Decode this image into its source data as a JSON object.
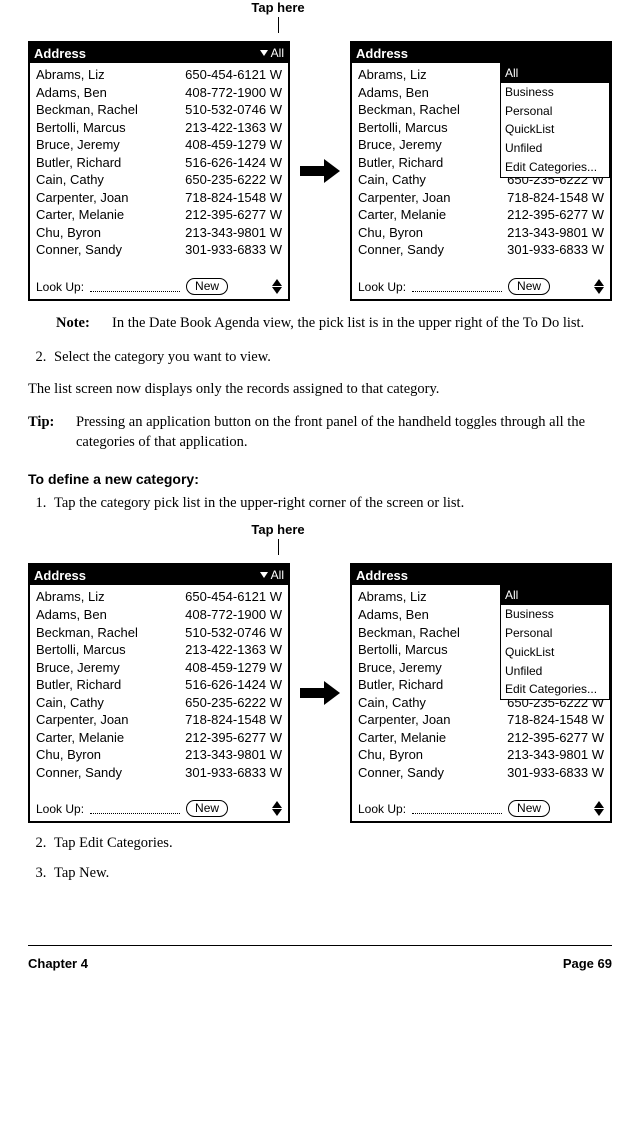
{
  "fig1": {
    "tap_here_label": "Tap here",
    "header_title": "Address",
    "cat_picker_value": "All",
    "lookup_label": "Look Up:",
    "new_btn_label": "New",
    "entries": [
      {
        "name": "Abrams, Liz",
        "num": "650-454-6121 W"
      },
      {
        "name": "Adams, Ben",
        "num": "408-772-1900 W"
      },
      {
        "name": "Beckman, Rachel",
        "num": "510-532-0746 W"
      },
      {
        "name": "Bertolli, Marcus",
        "num": "213-422-1363 W"
      },
      {
        "name": "Bruce, Jeremy",
        "num": "408-459-1279 W"
      },
      {
        "name": "Butler, Richard",
        "num": "516-626-1424 W"
      },
      {
        "name": "Cain, Cathy",
        "num": "650-235-6222 W"
      },
      {
        "name": "Carpenter, Joan",
        "num": "718-824-1548 W"
      },
      {
        "name": "Carter, Melanie",
        "num": "212-395-6277 W"
      },
      {
        "name": "Chu, Byron",
        "num": "213-343-9801 W"
      },
      {
        "name": "Conner, Sandy",
        "num": "301-933-6833 W"
      }
    ],
    "dropdown": {
      "selected": "All",
      "items": [
        "All",
        "Business",
        "Personal",
        "QuickList",
        "Unfiled",
        "Edit Categories..."
      ]
    }
  },
  "note": {
    "label": "Note:",
    "text": "In the Date Book Agenda view, the pick list is in the upper right of the To Do list."
  },
  "step2_text": "Select the category you want to view.",
  "post_step_text": "The list screen now displays only the records assigned to that category.",
  "tip": {
    "label": "Tip:",
    "text": "Pressing an application button on the front panel of the handheld toggles through all the categories of that application."
  },
  "section_heading": "To define a new category:",
  "def_step1": "Tap the category pick list in the upper-right corner of the screen or list.",
  "def_step2": "Tap Edit Categories.",
  "def_step3": "Tap New.",
  "footer": {
    "left": "Chapter 4",
    "right": "Page 69"
  }
}
